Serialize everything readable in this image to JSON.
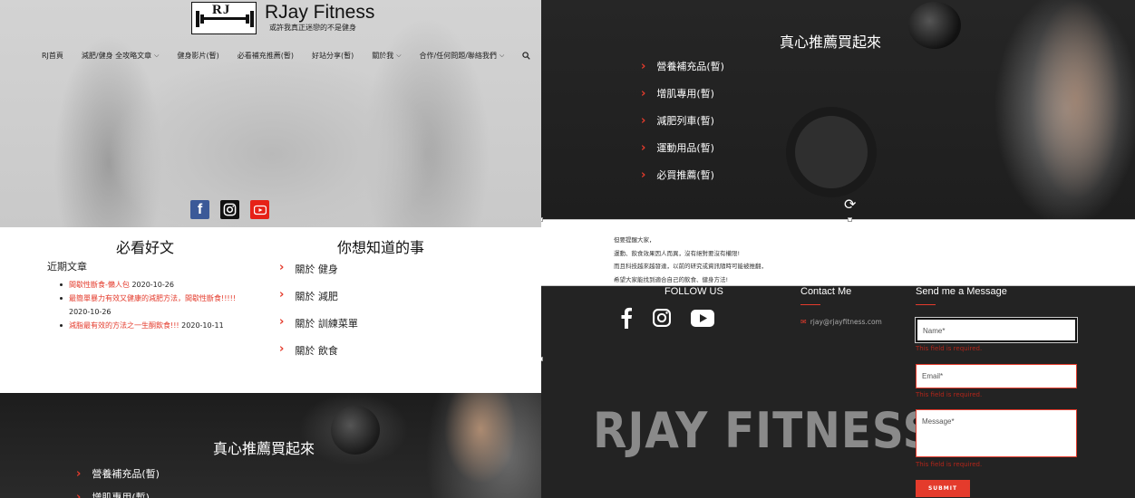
{
  "header": {
    "logo_text": "RJ",
    "brand_name": "RJay Fitness",
    "tagline": "或許我真正迷戀的不是健身"
  },
  "nav": {
    "items": [
      {
        "label": "RJ首頁",
        "dropdown": false
      },
      {
        "label": "減肥/健身 全攻略文章",
        "dropdown": true
      },
      {
        "label": "健身影片(暫)",
        "dropdown": false
      },
      {
        "label": "必看補充推薦(暫)",
        "dropdown": false
      },
      {
        "label": "好站分享(暫)",
        "dropdown": false
      },
      {
        "label": "關於我",
        "dropdown": true
      },
      {
        "label": "合作/任何問題/聯絡我們",
        "dropdown": true
      }
    ],
    "chevron": "⌵",
    "search_icon": "search-icon"
  },
  "hero_social": [
    "facebook-icon",
    "instagram-icon",
    "youtube-icon"
  ],
  "must_read": {
    "title": "必看好文",
    "recent_label": "近期文章",
    "posts": [
      {
        "title": "間歇性斷食-懶人包",
        "date": "2020-10-26"
      },
      {
        "title": "最簡單暴力有效又健康的減肥方法，間歇性斷食!!!!!",
        "date": "2020-10-26"
      },
      {
        "title": "減脂最有效的方法之一生酮飲食!!!",
        "date": "2020-10-11"
      }
    ]
  },
  "did_you_know": {
    "title": "你想知道的事",
    "items": [
      "關於 健身",
      "關於 減肥",
      "關於 訓練菜單",
      "關於 飲食"
    ]
  },
  "recommend": {
    "title": "真心推薦買起來",
    "items": [
      "營養補充品(暫)",
      "增肌專用(暫)",
      "減肥列車(暫)",
      "運動用品(暫)",
      "必買推薦(暫)"
    ],
    "bottom_visible_items": [
      "營養補充品(暫)",
      "增肌專用(暫)"
    ]
  },
  "note": {
    "lines": [
      "但要提醒大家，",
      "運動、飲食效果因人而異，沒有絕對要沒有權限!",
      "而且科技越來越發達，以前的研究或資訊隨時可能被推翻，",
      "希望大家能找到適合自己的飲食、健身方法!"
    ]
  },
  "footer": {
    "follow_title": "FOLLOW US",
    "contact_title": "Contact Me",
    "contact_email": "rjay@rjayfitness.com",
    "message_title": "Send me a Message",
    "big_brand": "RJAY FITNESS",
    "form": {
      "name_placeholder": "Name*",
      "email_placeholder": "Email*",
      "message_placeholder": "Message*",
      "required_error": "This field is required.",
      "submit_label": "SUBMIT"
    }
  },
  "colors": {
    "accent": "#e43b2c",
    "dark_bg": "#232323",
    "facebook": "#3b5998",
    "youtube": "#e62117"
  }
}
